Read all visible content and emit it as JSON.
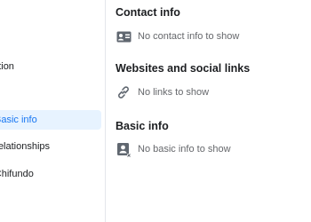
{
  "sidebar": {
    "items": [
      {
        "label": "Education",
        "active": false
      },
      {
        "label": "Basic info",
        "active": true
      },
      {
        "label": "Relationships",
        "active": false
      },
      {
        "label": "About Chifundo",
        "active": false
      }
    ]
  },
  "main": {
    "sections": [
      {
        "title": "Contact info",
        "empty_label": "No contact info to show",
        "icon": "contact-card-icon"
      },
      {
        "title": "Websites and social links",
        "empty_label": "No links to show",
        "icon": "link-icon"
      },
      {
        "title": "Basic info",
        "empty_label": "No basic info to show",
        "icon": "profile-card-icon"
      }
    ]
  },
  "colors": {
    "accent": "#1877f2",
    "active_bg": "#e7f3ff",
    "secondary_text": "#65676b",
    "icon_gray": "#606770"
  }
}
